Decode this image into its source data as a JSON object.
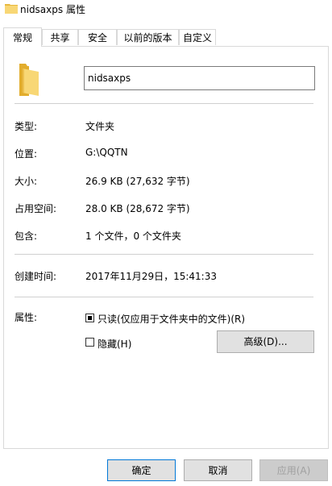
{
  "window": {
    "title": "nidsaxps 属性"
  },
  "tabs": [
    {
      "label": "常规"
    },
    {
      "label": "共享"
    },
    {
      "label": "安全"
    },
    {
      "label": "以前的版本"
    },
    {
      "label": "自定义"
    }
  ],
  "general": {
    "name_value": "nidsaxps",
    "type_label": "类型:",
    "type_value": "文件夹",
    "location_label": "位置:",
    "location_value": "G:\\QQTN",
    "size_label": "大小:",
    "size_value": "26.9 KB (27,632 字节)",
    "disk_label": "占用空间:",
    "disk_value": "28.0 KB (28,672 字节)",
    "contains_label": "包含:",
    "contains_value": "1 个文件，0 个文件夹",
    "created_label": "创建时间:",
    "created_value": "2017年11月29日，15:41:33",
    "attributes_label": "属性:",
    "readonly_label": "只读(仅应用于文件夹中的文件)(R)",
    "hidden_label": "隐藏(H)",
    "advanced_button": "高级(D)..."
  },
  "footer": {
    "ok": "确定",
    "cancel": "取消",
    "apply": "应用(A)"
  },
  "colors": {
    "folder": "#F8D775",
    "focus_border": "#0078d7"
  }
}
